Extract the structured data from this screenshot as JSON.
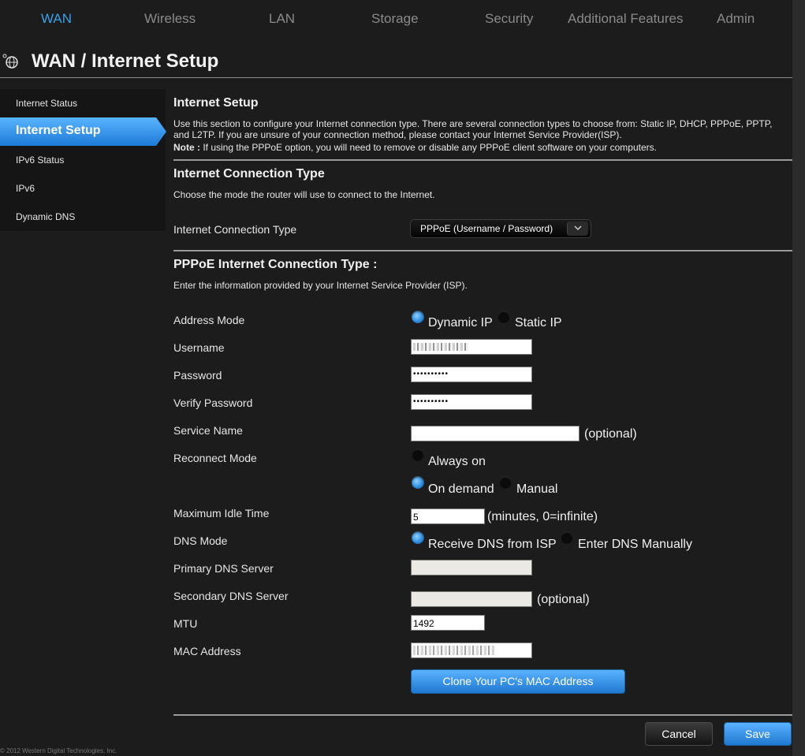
{
  "top_nav": [
    {
      "label": "WAN",
      "active": true
    },
    {
      "label": "Wireless"
    },
    {
      "label": "LAN"
    },
    {
      "label": "Storage"
    },
    {
      "label": "Security"
    },
    {
      "label": "Additional Features"
    },
    {
      "label": "Admin"
    }
  ],
  "page_title": "WAN / Internet Setup",
  "sidebar": {
    "items": [
      {
        "label": "Internet Status"
      },
      {
        "label": "Internet Setup",
        "active": true
      },
      {
        "label": "IPv6 Status"
      },
      {
        "label": "IPv6"
      },
      {
        "label": "Dynamic DNS"
      }
    ]
  },
  "internet_setup": {
    "title": "Internet Setup",
    "description": "Use this section to configure your Internet connection type. There are several connection types to choose from: Static IP, DHCP, PPPoE, PPTP, and L2TP. If you are unsure of your connection method, please contact your Internet Service Provider(ISP).",
    "note_label": "Note :",
    "note_text": " If using the PPPoE option, you will need to remove or disable any PPPoE client software on your computers."
  },
  "connection_type": {
    "title": "Internet Connection Type",
    "description": "Choose the mode the router will use to connect to the Internet.",
    "label": "Internet Connection Type",
    "selected": "PPPoE (Username / Password)"
  },
  "pppoe": {
    "title": "PPPoE Internet Connection Type :",
    "description": "Enter the information provided by your Internet Service Provider (ISP).",
    "address_mode": {
      "label": "Address Mode",
      "options": [
        "Dynamic IP",
        "Static IP"
      ],
      "selected": "Dynamic IP"
    },
    "username": {
      "label": "Username"
    },
    "password": {
      "label": "Password",
      "value": "••••••••••"
    },
    "verify_password": {
      "label": "Verify Password",
      "value": "••••••••••"
    },
    "service_name": {
      "label": "Service Name",
      "value": "",
      "hint": "(optional)"
    },
    "reconnect_mode": {
      "label": "Reconnect Mode",
      "options": [
        "Always on",
        "On demand",
        "Manual"
      ],
      "selected": "On demand"
    },
    "max_idle_time": {
      "label": "Maximum Idle Time",
      "value": "5",
      "hint": "(minutes, 0=infinite)"
    },
    "dns_mode": {
      "label": "DNS Mode",
      "options": [
        "Receive DNS from ISP",
        "Enter DNS Manually"
      ],
      "selected": "Receive DNS from ISP"
    },
    "primary_dns": {
      "label": "Primary DNS Server",
      "value": ""
    },
    "secondary_dns": {
      "label": "Secondary DNS Server",
      "value": "",
      "hint": "(optional)"
    },
    "mtu": {
      "label": "MTU",
      "value": "1492"
    },
    "mac_address": {
      "label": "MAC Address"
    },
    "clone_button": "Clone Your PC's MAC Address"
  },
  "buttons": {
    "cancel": "Cancel",
    "save": "Save"
  },
  "footer": "© 2012 Western Digital Technologies, Inc.",
  "colors": {
    "accent": "#3aa0e8",
    "background": "#1c1c1c",
    "sidebar": "#151515"
  }
}
